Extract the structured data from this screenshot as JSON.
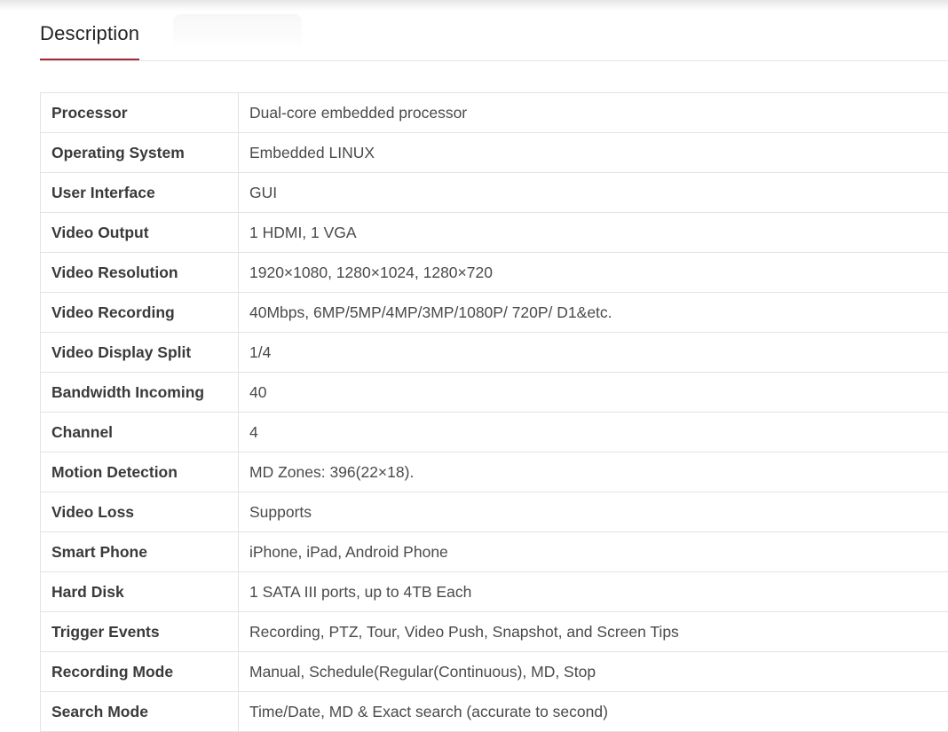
{
  "tabs": {
    "active_label": "Description"
  },
  "specs": [
    {
      "label": "Processor",
      "value": "Dual-core embedded processor"
    },
    {
      "label": "Operating System",
      "value": "Embedded LINUX"
    },
    {
      "label": "User Interface",
      "value": "GUI"
    },
    {
      "label": "Video Output",
      "value": "1 HDMI, 1 VGA"
    },
    {
      "label": "Video Resolution",
      "value": "1920×1080, 1280×1024, 1280×720"
    },
    {
      "label": "Video Recording",
      "value": "40Mbps, 6MP/5MP/4MP/3MP/1080P/ 720P/ D1&etc."
    },
    {
      "label": "Video Display Split",
      "value": "1/4"
    },
    {
      "label": "Bandwidth Incoming",
      "value": "40"
    },
    {
      "label": "Channel",
      "value": "4"
    },
    {
      "label": "Motion Detection",
      "value": "MD Zones: 396(22×18)."
    },
    {
      "label": "Video Loss",
      "value": "Supports"
    },
    {
      "label": "Smart Phone",
      "value": "iPhone, iPad, Android Phone"
    },
    {
      "label": "Hard Disk",
      "value": "1 SATA III ports, up to 4TB Each"
    },
    {
      "label": "Trigger Events",
      "value": "Recording, PTZ, Tour, Video Push, Snapshot, and Screen Tips"
    },
    {
      "label": "Recording Mode",
      "value": "Manual, Schedule(Regular(Continuous), MD, Stop"
    },
    {
      "label": "Search Mode",
      "value": "Time/Date, MD & Exact search (accurate to second)"
    }
  ],
  "colors": {
    "accent": "#a4283a",
    "border": "#e3e3e3"
  }
}
